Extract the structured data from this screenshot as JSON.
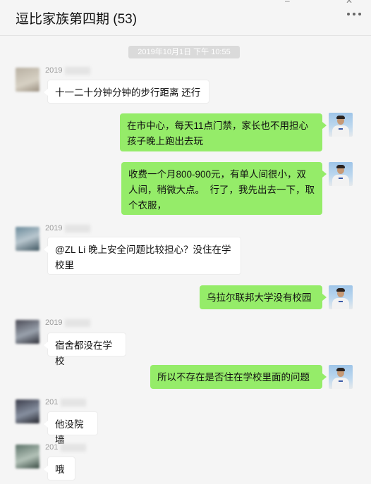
{
  "window": {
    "minimize": "–",
    "close": "✕"
  },
  "header": {
    "title": "逗比家族第四期 (53)",
    "more_icon": "more-icon"
  },
  "timestamp": "2019年10月1日 下午 10:55",
  "messages": [
    {
      "side": "left",
      "sender": "2019",
      "text": "十一二十分钟分钟的步行距离 还行"
    },
    {
      "side": "right",
      "text": "在市中心，每天11点门禁，家长也不用担心孩子晚上跑出去玩"
    },
    {
      "side": "right",
      "text": "收费一个月800-900元，有单人间很小，双人间，稍微大点。  行了，我先出去一下，取个衣服，"
    },
    {
      "side": "left",
      "sender": "2019",
      "text": "@ZL Li 晚上安全问题比较担心？没住在学校里"
    },
    {
      "side": "right",
      "text": "乌拉尔联邦大学没有校园"
    },
    {
      "side": "left",
      "sender": "2019",
      "text": "宿舍都没在学校"
    },
    {
      "side": "right",
      "text": "所以不存在是否住在学校里面的问题"
    },
    {
      "side": "left",
      "sender": "201",
      "text": "他没院墙"
    },
    {
      "side": "left",
      "sender": "201",
      "text": "哦"
    }
  ]
}
